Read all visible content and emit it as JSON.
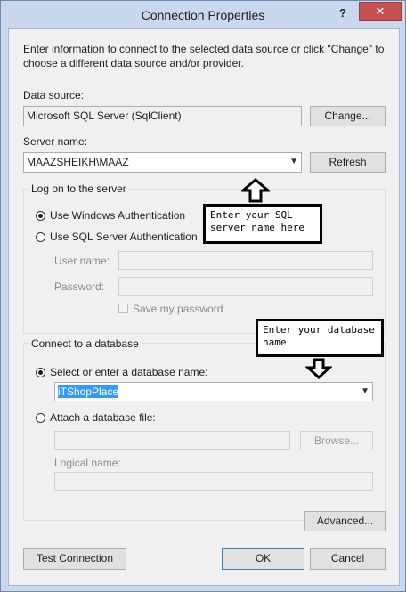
{
  "window": {
    "title": "Connection Properties",
    "help_glyph": "?",
    "close_glyph": "✕"
  },
  "intro": "Enter information to connect to the selected data source or click \"Change\" to choose a different data source and/or provider.",
  "data_source": {
    "label": "Data source:",
    "value": "Microsoft SQL Server (SqlClient)",
    "change_button": "Change..."
  },
  "server": {
    "label": "Server name:",
    "value": "MAAZSHEIKH\\MAAZ",
    "refresh_button": "Refresh"
  },
  "logon": {
    "group_title": "Log on to the server",
    "windows_auth": "Use Windows Authentication",
    "sql_auth": "Use SQL Server Authentication",
    "username_label": "User name:",
    "password_label": "Password:",
    "save_password": "Save my password"
  },
  "database": {
    "group_title": "Connect to a database",
    "select_option": "Select or enter a database name:",
    "selected_db": "iTShopPlace",
    "attach_option": "Attach a database file:",
    "browse_button": "Browse...",
    "logical_label": "Logical name:"
  },
  "buttons": {
    "advanced": "Advanced...",
    "test_connection": "Test Connection",
    "ok": "OK",
    "cancel": "Cancel"
  },
  "annotations": {
    "server_note": "Enter your SQL\nserver name here",
    "db_note": "Enter your database\nname"
  },
  "colors": {
    "close_red": "#c75050",
    "frame": "#c9d8ec",
    "selection": "#3399ff"
  }
}
